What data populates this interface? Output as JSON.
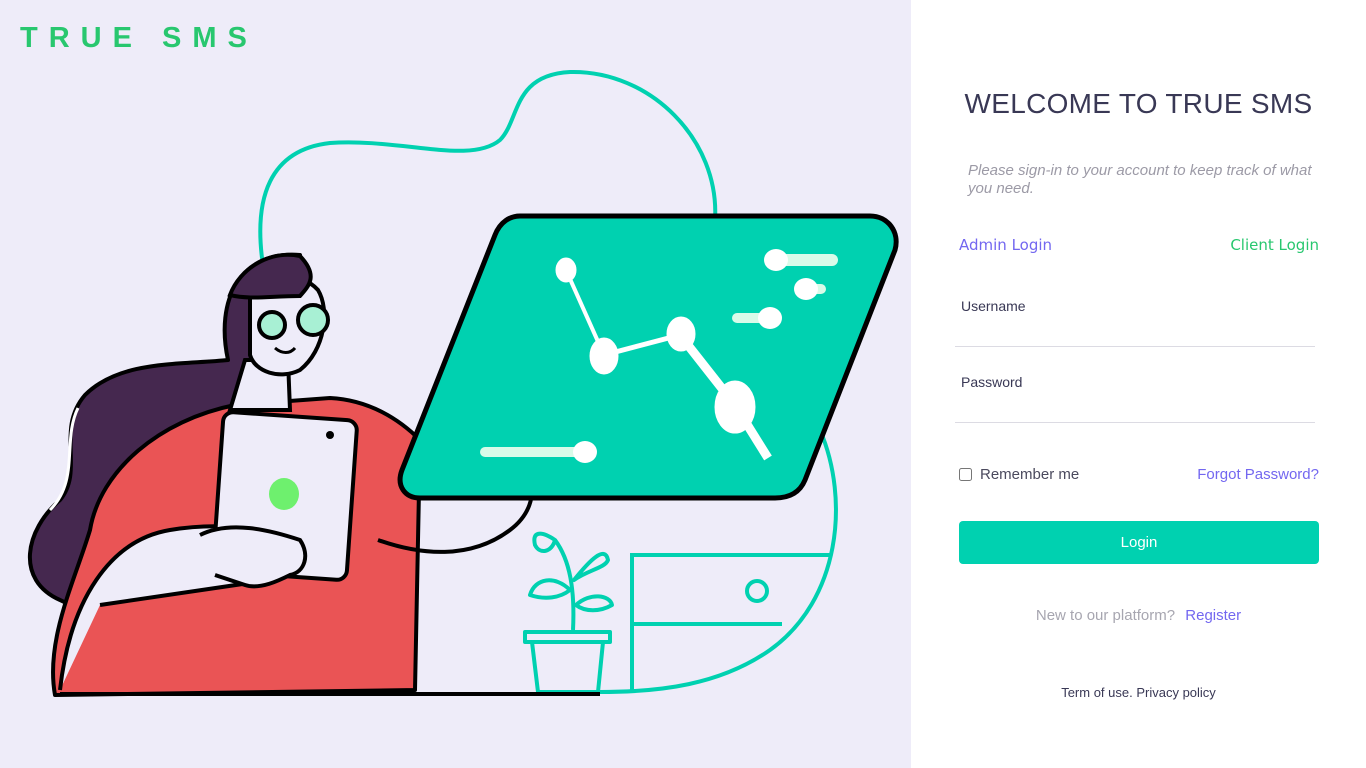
{
  "brand": {
    "name": "TRUE SMS"
  },
  "login": {
    "title": "WELCOME TO TRUE SMS",
    "subtitle": "Please sign-in to your account to keep track of what you need.",
    "admin_link": "Admin Login",
    "client_link": "Client Login",
    "username_label": "Username",
    "username_value": "",
    "password_label": "Password",
    "password_value": "",
    "remember_label": "Remember me",
    "remember_checked": false,
    "forgot_link": "Forgot Password?",
    "login_button": "Login",
    "new_user_text": "New to our platform?",
    "register_link": "Register",
    "terms_text": "Term of use.",
    "privacy_text": "Privacy policy"
  },
  "colors": {
    "brand_green": "#28c76f",
    "accent_teal": "#00d1b0",
    "link_purple": "#7367f0",
    "left_background": "#eeecf9",
    "shirt_red": "#ea5455",
    "hair_purple": "#45284f"
  }
}
